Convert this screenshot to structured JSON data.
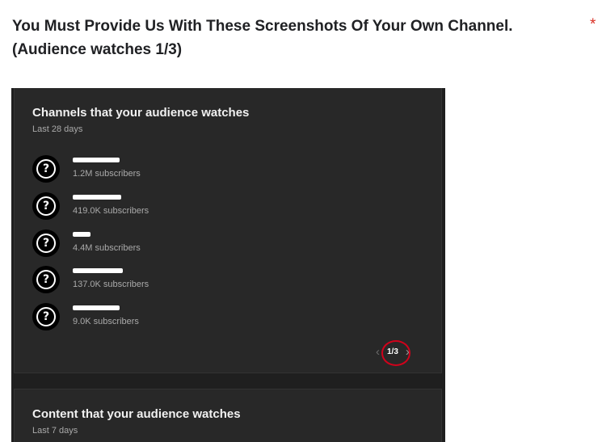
{
  "question": {
    "text": "You Must Provide Us With These Screenshots Of Your Own Channel. (Audience watches 1/3)",
    "required_marker": "*"
  },
  "screenshot": {
    "card1": {
      "title": "Channels that your audience watches",
      "subtitle": "Last 28 days",
      "channels": [
        {
          "subscribers": "1.2M subscribers",
          "avatar_icon": "question-mark-icon"
        },
        {
          "subscribers": "419.0K subscribers",
          "avatar_icon": "question-mark-icon"
        },
        {
          "subscribers": "4.4M subscribers",
          "avatar_icon": "question-mark-icon"
        },
        {
          "subscribers": "137.0K subscribers",
          "avatar_icon": "question-mark-icon"
        },
        {
          "subscribers": "9.0K subscribers",
          "avatar_icon": "question-mark-icon"
        }
      ],
      "pager": {
        "prev": "‹",
        "page": "1/3",
        "next": "›"
      }
    },
    "card2": {
      "title": "Content that your audience watches",
      "subtitle": "Last 7 days"
    }
  },
  "colors": {
    "dark_bg": "#1f1f1f",
    "card_bg": "#282828",
    "required": "#d93025",
    "annotation_circle": "#d0021b"
  }
}
